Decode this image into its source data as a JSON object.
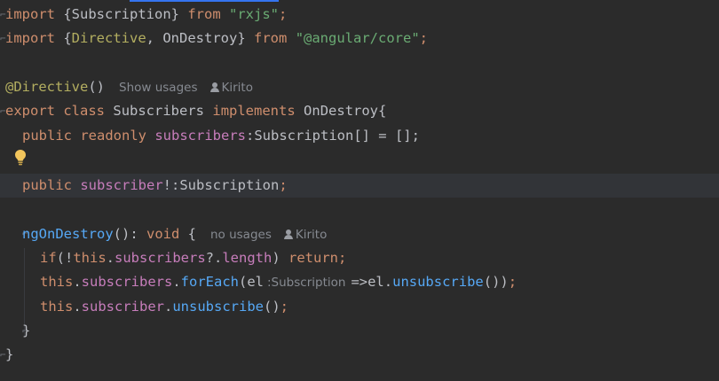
{
  "editor": {
    "theme_colors": {
      "background": "#2b2b2b",
      "keyword": "#cf8e6d",
      "string": "#6aab73",
      "annotation": "#b3ae60",
      "field": "#c77dbb",
      "function": "#56a8f5",
      "plain": "#bcbec4",
      "hint": "#868a91"
    },
    "lines": {
      "l1": {
        "kw_import": "import",
        "brace_open": " {",
        "name": "Subscription",
        "brace_close": "} ",
        "kw_from": "from",
        "space": " ",
        "module": "\"rxjs\"",
        "semi": ";"
      },
      "l2": {
        "kw_import": "import",
        "brace_open": " {",
        "name1": "Directive",
        "comma": ", ",
        "name2": "OnDestroy",
        "brace_close": "} ",
        "kw_from": "from",
        "space": " ",
        "module": "\"@angular/core\"",
        "semi": ";"
      },
      "l4": {
        "annotation": "@Directive",
        "parens": "()",
        "hint_usages": "Show usages",
        "hint_author": "Kirito"
      },
      "l5": {
        "kw_export": "export",
        "kw_class": "class",
        "class_name": "Subscribers",
        "kw_implements": "implements",
        "iface": "OnDestroy",
        "brace": "{"
      },
      "l6": {
        "kw_public": "public",
        "kw_readonly": "readonly",
        "field": "subscribers",
        "type": ":Subscription[] = [];"
      },
      "l8": {
        "kw_public": "public",
        "field": "subscriber",
        "type": "!:Subscription",
        "semi": ";"
      },
      "l10": {
        "method": "ngOnDestroy",
        "params": "(): ",
        "kw_void": "void",
        "brace": " {",
        "hint_usages": "no usages",
        "hint_author": "Kirito"
      },
      "l11": {
        "kw_if": "if",
        "paren_open": "(!",
        "kw_this": "this",
        "dot": ".",
        "field": "subscribers",
        "rest": "?.",
        "field2": "length",
        "paren_close": ") ",
        "kw_return": "return",
        "semi": ";"
      },
      "l12": {
        "kw_this": "this",
        "dot": ".",
        "field": "subscribers",
        "dot2": ".",
        "method": "forEach",
        "paren": "(el",
        "inlay_type": ":Subscription",
        "arrow": "=>el.",
        "method2": "unsubscribe",
        "close": "())",
        "semi": ";"
      },
      "l13": {
        "kw_this": "this",
        "dot": ".",
        "field": "subscriber",
        "dot2": ".",
        "method": "unsubscribe",
        "close": "()",
        "semi": ";"
      },
      "l14": {
        "brace": "}"
      },
      "l15": {
        "brace": "}"
      }
    }
  }
}
